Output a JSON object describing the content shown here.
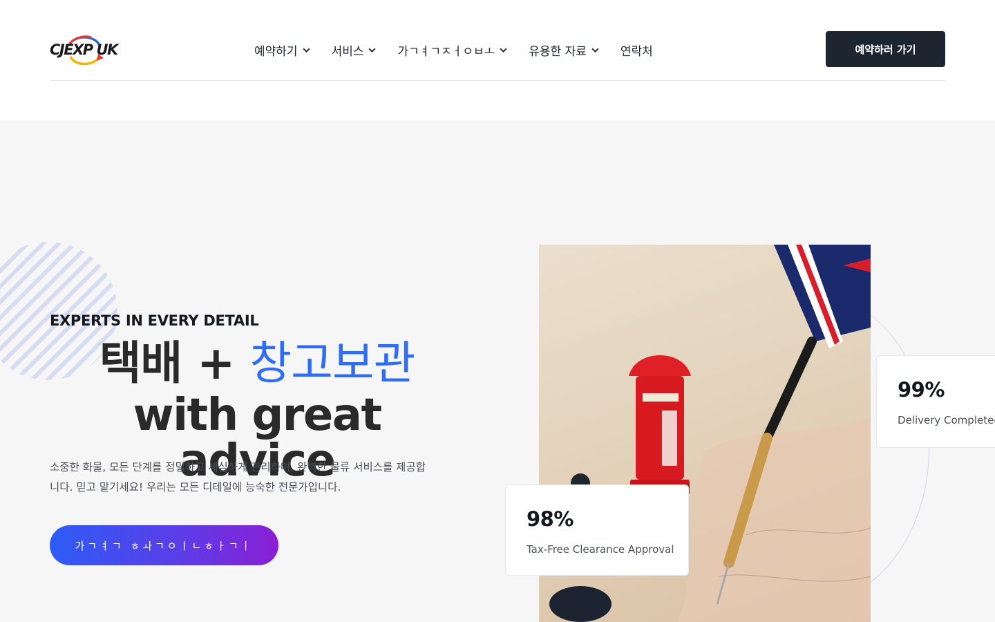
{
  "brand": {
    "logo_text": "CJEXP UK",
    "logo_icon": "swoosh-arrow-icon",
    "colors": {
      "logo_red": "#e53935",
      "logo_yellow": "#f5b400",
      "logo_blue": "#2a66d8"
    }
  },
  "nav": {
    "items": [
      {
        "label": "예약하기",
        "dropdown": true
      },
      {
        "label": "서비스",
        "dropdown": true
      },
      {
        "label": "가ㄱㅕㄱㅈㅓㅇㅂㅗ",
        "dropdown": true
      },
      {
        "label": "유용한 자료",
        "dropdown": true
      },
      {
        "label": "연락처",
        "dropdown": false
      }
    ],
    "cta_label": "예약하러 가기"
  },
  "hero": {
    "eyebrow": "EXPERTS IN EVERY DETAIL",
    "headline_part1": "택배 + ",
    "headline_highlight": "창고보관",
    "headline_line2": "with great advice",
    "description": "소중한 화물, 모든 단계를 정밀하고 세심하게 관리하며, 완벽한 물류 서비스를 제공합니다. 믿고 맡기세요! 우리는 모든 디테일에 능숙한 전문가입니다.",
    "button_label": "가ㄱㅕㄱ ㅎㅘㄱㅇㅣㄴㅎㅏㄱㅣ",
    "image": "london-telephone-booth-and-dart-on-map-photo"
  },
  "stats": [
    {
      "value": "99%",
      "label": "Delivery Completed"
    },
    {
      "value": "98%",
      "label": "Tax-Free Clearance Approval"
    }
  ],
  "colors": {
    "accent_blue": "#2f6df6",
    "dark_button": "#1c2530",
    "gradient_start": "#2d5cf6",
    "gradient_end": "#8a1fd4",
    "hero_bg": "#f6f6f6"
  }
}
